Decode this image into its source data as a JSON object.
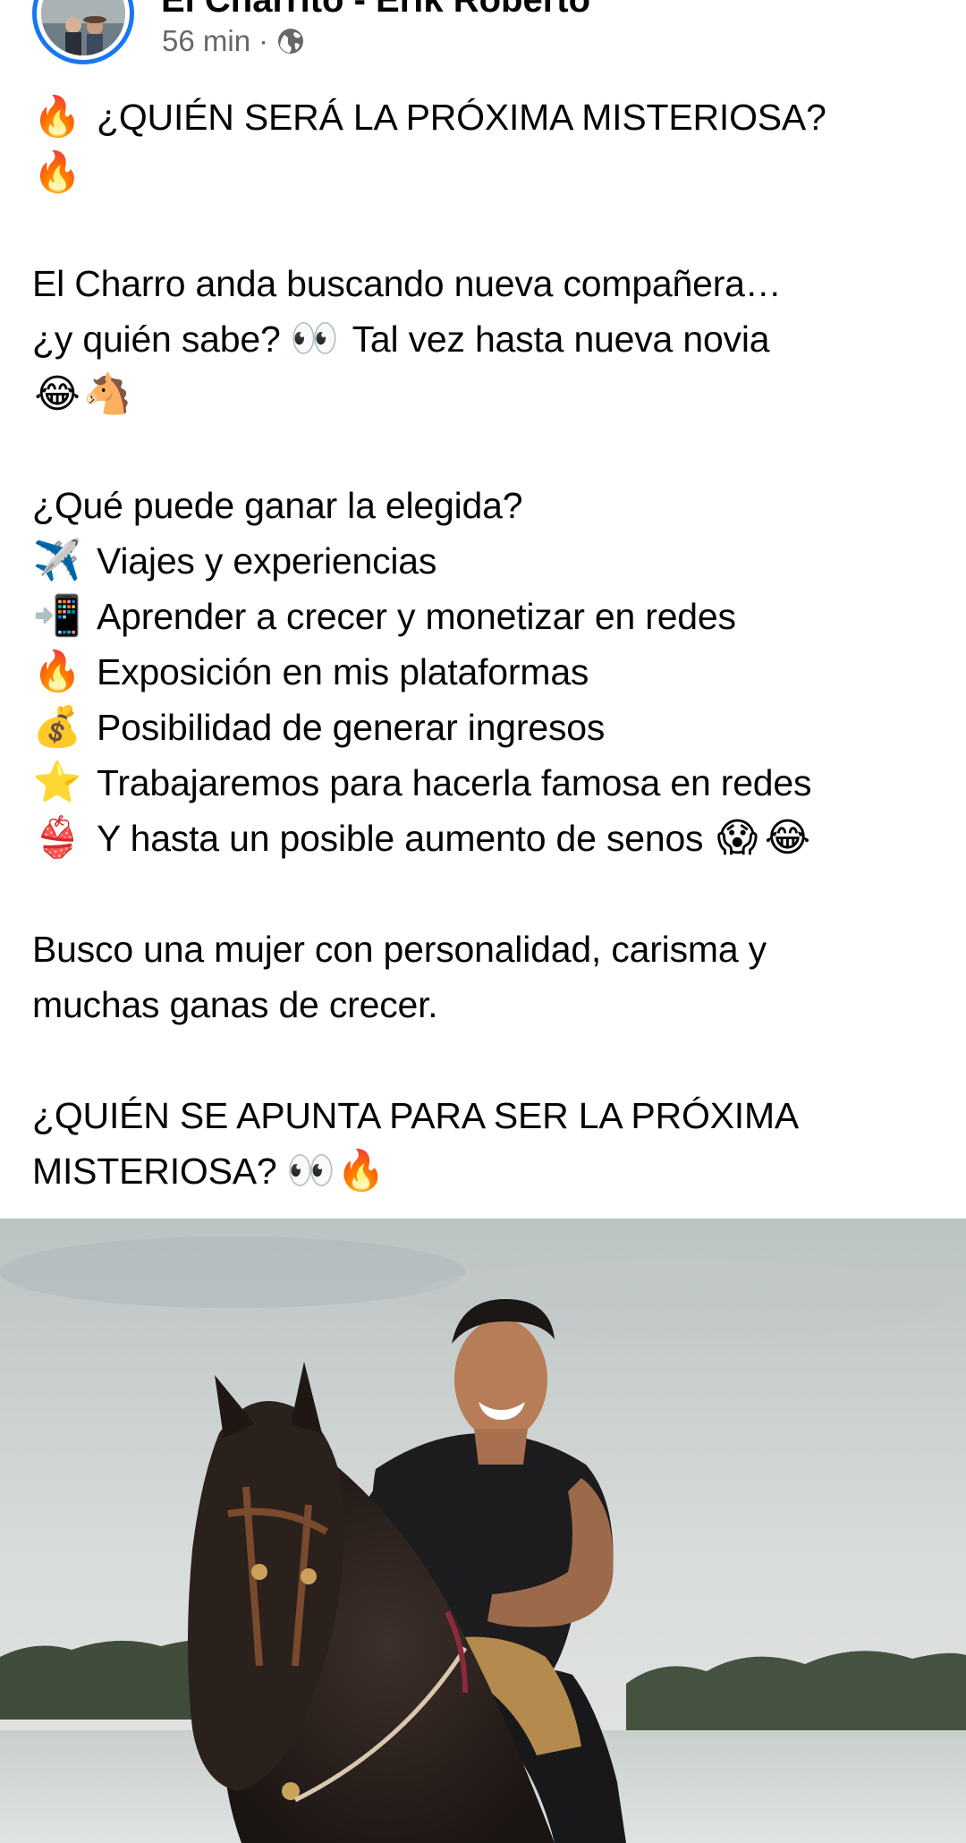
{
  "post": {
    "author": "El Charrito - Erik Roberto",
    "time": "56 min",
    "separator": "·",
    "privacy_icon": "globe-icon",
    "close_icon": "close-icon",
    "avatar_icon": "profile-photo"
  },
  "lines": {
    "title": "¿QUIÉN SERÁ LA PRÓXIMA MISTERIOSA?",
    "intro1": "El Charro anda buscando nueva compañera…",
    "intro2a": "¿y quién sabe?",
    "intro2b": "Tal vez hasta nueva novia",
    "question": "¿Qué puede ganar la elegida?",
    "benefit1": "Viajes y experiencias",
    "benefit2": "Aprender a crecer y monetizar en redes",
    "benefit3": "Exposición en mis plataformas",
    "benefit4": "Posibilidad de generar ingresos",
    "benefit5": "Trabajaremos para hacerla famosa en redes",
    "benefit6": "Y hasta un posible aumento de senos",
    "busco1": "Busco una mujer con personalidad, carisma y",
    "busco2": "muchas ganas de crecer.",
    "cta1": "¿QUIÉN SE APUNTA PARA SER LA PRÓXIMA",
    "cta2": "MISTERIOSA?"
  },
  "emojis": {
    "fire": "🔥",
    "eyes": "👀",
    "laugh": "😂",
    "horse": "🐴",
    "plane": "✈️",
    "phone": "📲",
    "money": "💰",
    "star": "⭐",
    "bikini": "👙",
    "scream": "😱"
  },
  "photo": {
    "description_icon": "man-riding-horse-photo"
  },
  "colors": {
    "link_blue": "#1877f2",
    "meta_gray": "#65676b",
    "text": "#050505"
  }
}
